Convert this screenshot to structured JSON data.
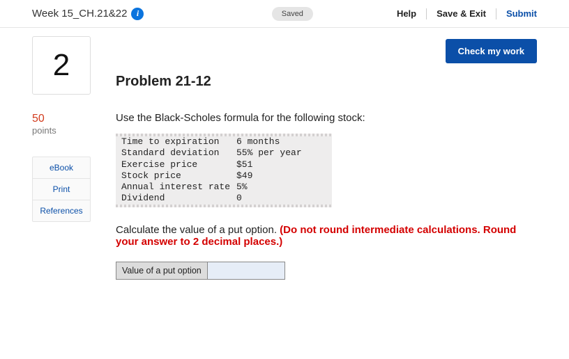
{
  "header": {
    "assignment_title": "Week 15_CH.21&22",
    "info_icon_glyph": "i",
    "saved_label": "Saved",
    "links": {
      "help": "Help",
      "save_exit": "Save & Exit",
      "submit": "Submit"
    }
  },
  "question": {
    "number": "2",
    "points_value": "50",
    "points_label": "points"
  },
  "side_links": {
    "ebook": "eBook",
    "print": "Print",
    "references": "References"
  },
  "buttons": {
    "check_work": "Check my work"
  },
  "problem": {
    "title": "Problem 21-12",
    "instruction": "Use the Black-Scholes formula for the following stock:",
    "rows": [
      {
        "label": "Time to expiration",
        "value": "6 months"
      },
      {
        "label": "Standard deviation",
        "value": "55% per year"
      },
      {
        "label": "Exercise price",
        "value": "$51"
      },
      {
        "label": "Stock price",
        "value": "$49"
      },
      {
        "label": "Annual interest rate",
        "value": "5%"
      },
      {
        "label": "Dividend",
        "value": "0"
      }
    ],
    "calc_prompt": "Calculate the value of a put option. ",
    "calc_note": "(Do not round intermediate calculations. Round your answer to 2 decimal places.)",
    "answer_label": "Value of a put option",
    "answer_value": ""
  }
}
